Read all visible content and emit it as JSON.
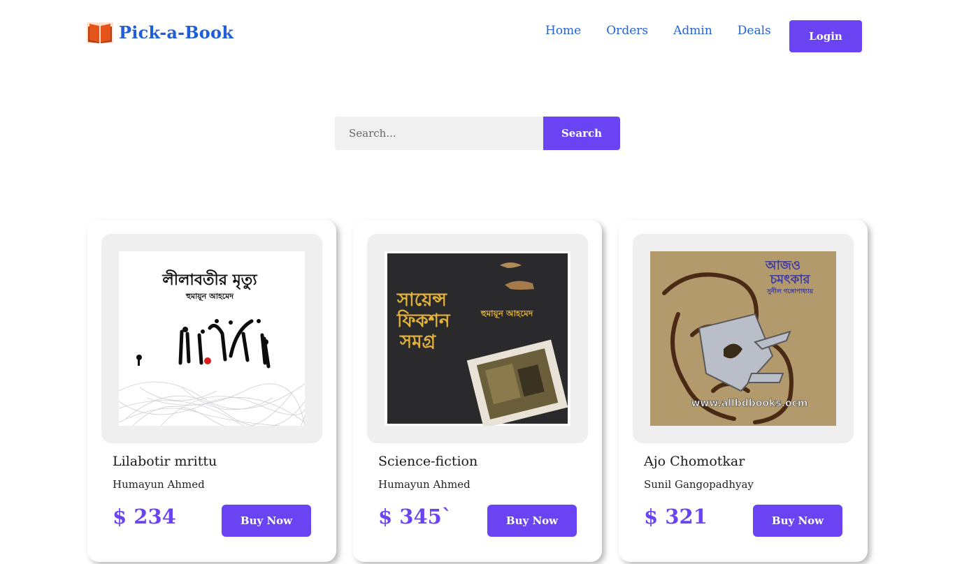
{
  "header": {
    "brand_name": "Pick-a-Book",
    "brand_icon": "open-book-icon",
    "nav": [
      "Home",
      "Orders",
      "Admin",
      "Deals"
    ],
    "login_label": "Login"
  },
  "search": {
    "placeholder": "Search...",
    "button_label": "Search"
  },
  "books": [
    {
      "title": "Lilabotir mrittu",
      "author": "Humayun Ahmed",
      "price": "$ 234",
      "buy_label": "Buy Now",
      "cover_title": "লীলাবতীর মৃত্যু",
      "cover_author": "হুমায়ূন আহমেদ"
    },
    {
      "title": "Science-fiction",
      "author": "Humayun Ahmed",
      "price": "$ 345`",
      "buy_label": "Buy Now",
      "cover_title_1": "সায়েন্স",
      "cover_title_2": "ফিকশন",
      "cover_title_3": "সমগ্র",
      "cover_author": "হুমায়ূন আহমেদ"
    },
    {
      "title": "Ajo Chomotkar",
      "author": "Sunil Gangopadhyay",
      "price": "$ 321",
      "buy_label": "Buy Now",
      "cover_title_1": "আজও",
      "cover_title_2": "চমৎকার",
      "cover_author": "সুনীল গঙ্গোপাধ্যায়",
      "cover_watermark": "www.allbdbooks.ocm"
    }
  ],
  "colors": {
    "accent": "#6a44f2",
    "link": "#2364d8",
    "card_bg": "#efefef"
  }
}
